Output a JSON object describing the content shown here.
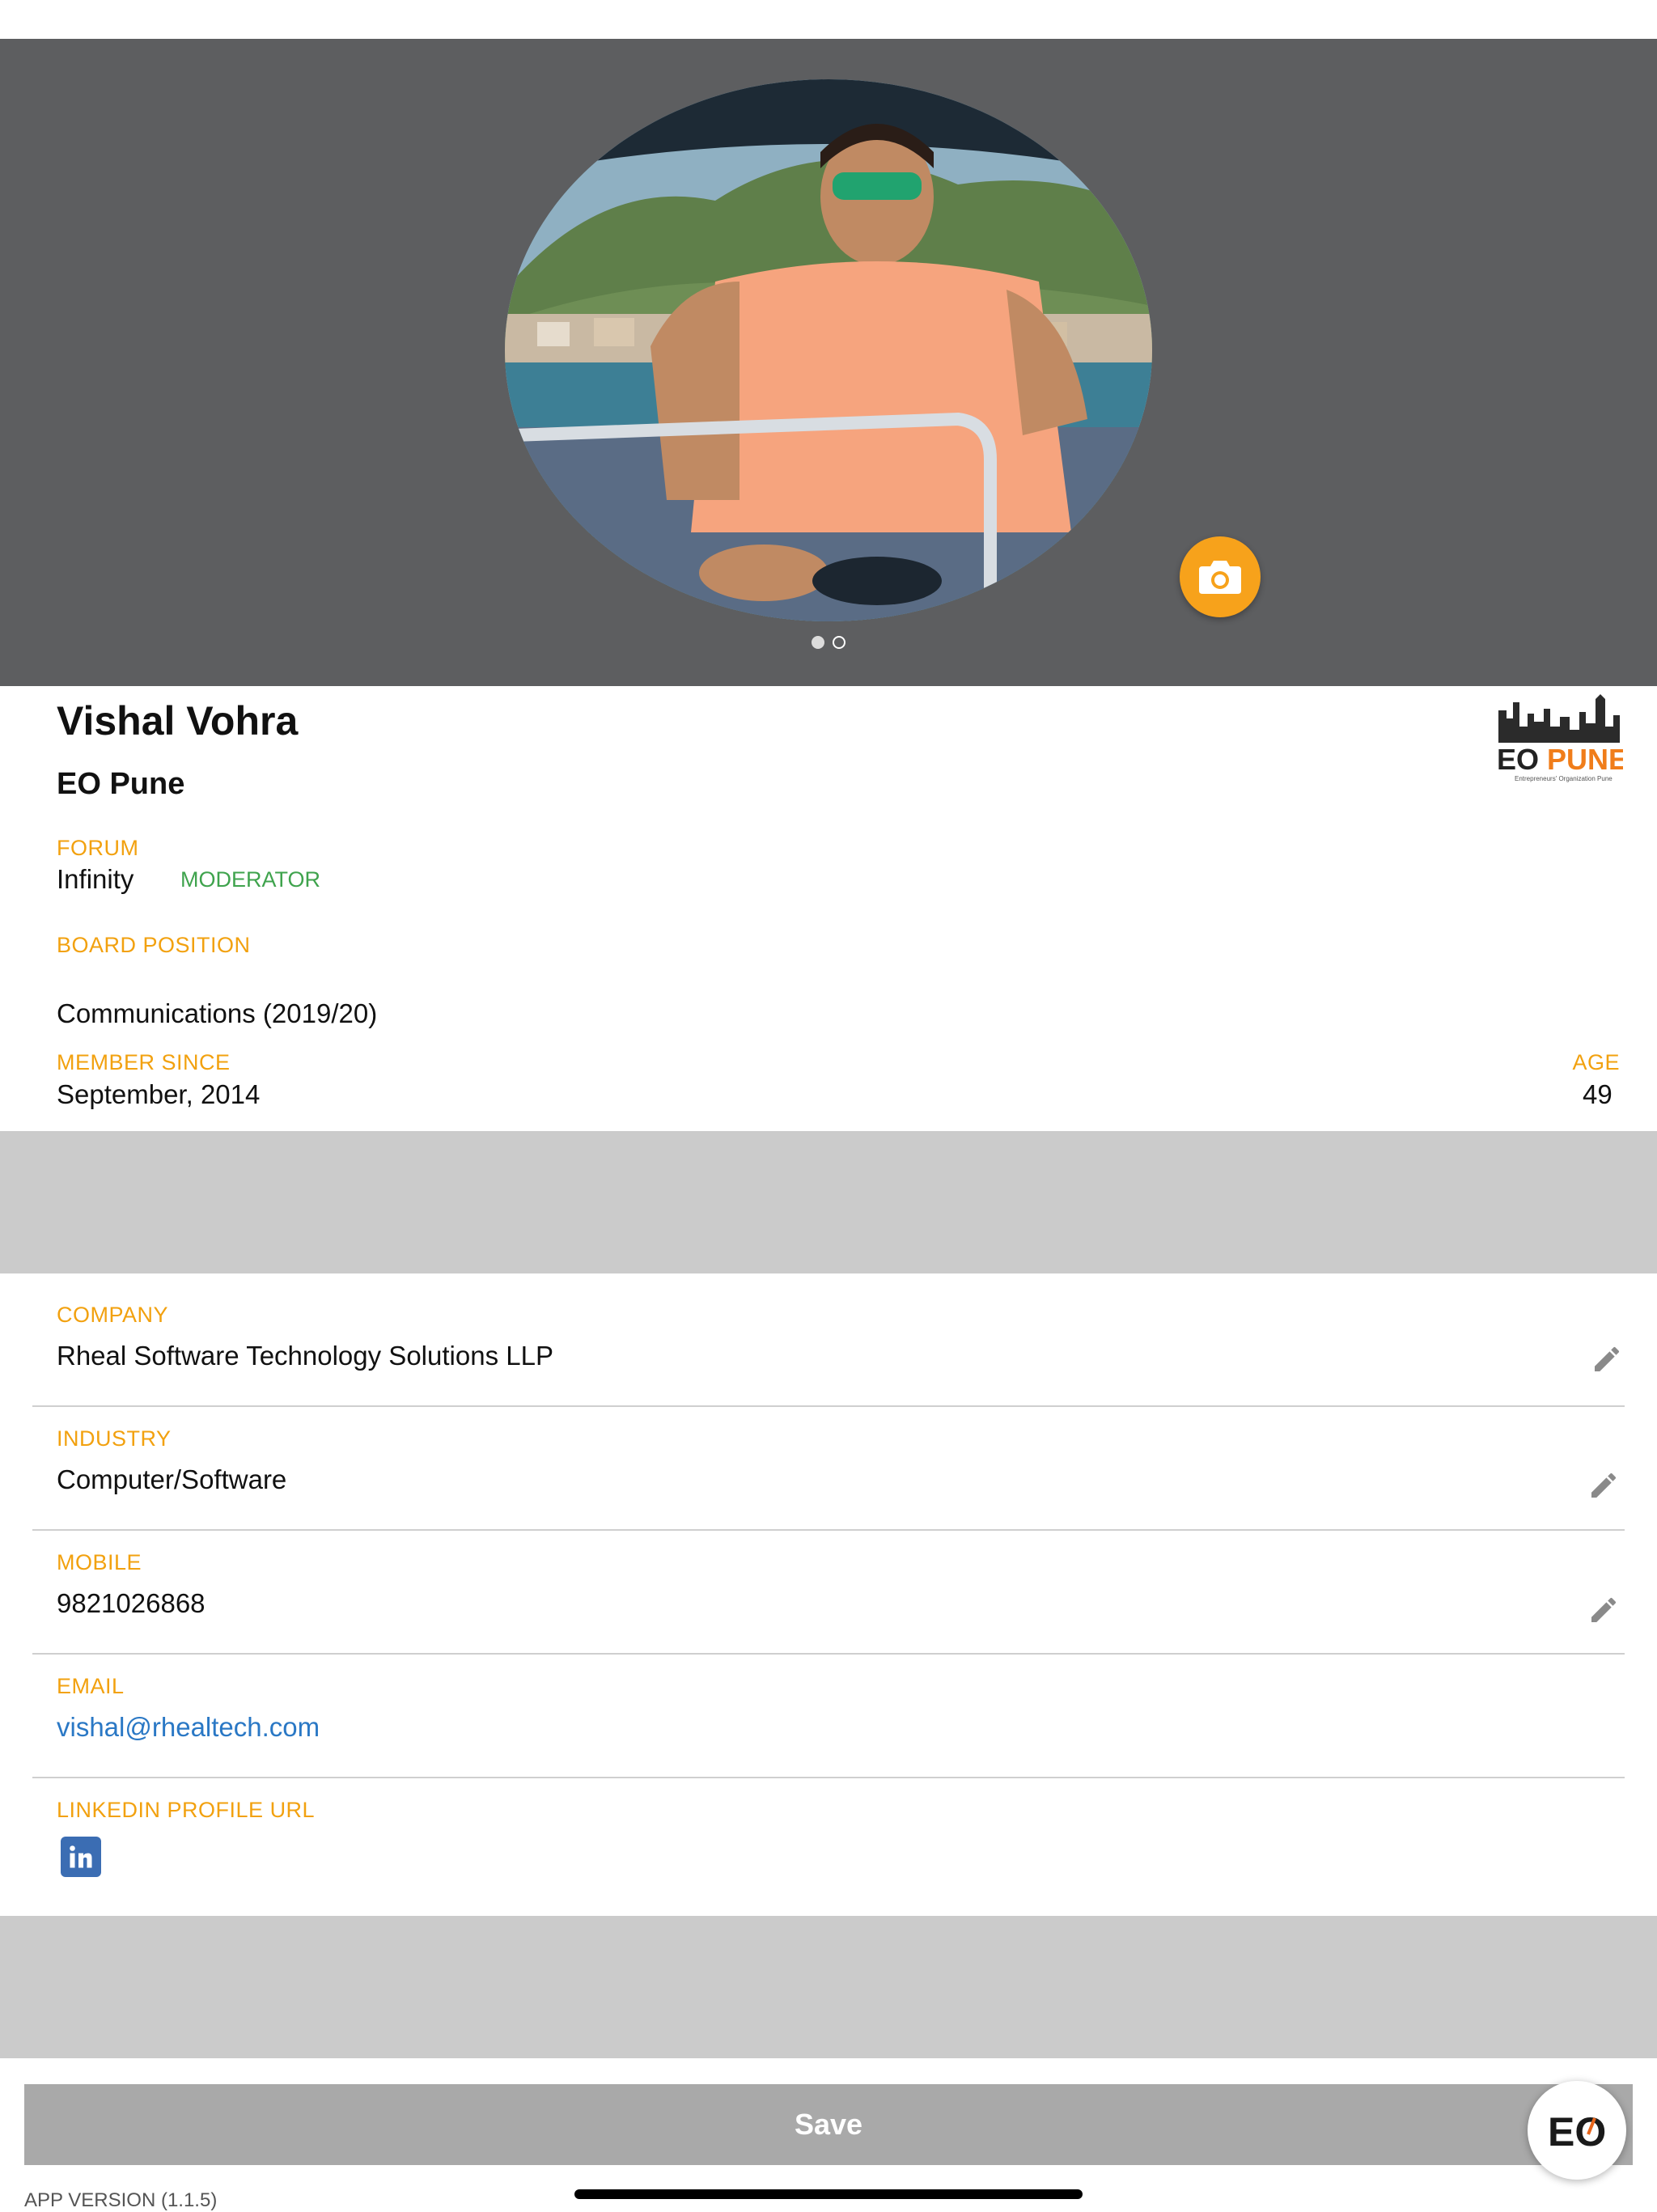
{
  "profile": {
    "name": "Vishal Vohra",
    "chapter": "EO Pune",
    "forum_label": "FORUM",
    "forum_value": "Infinity",
    "forum_role": "MODERATOR",
    "board_position_label": "BOARD POSITION",
    "board_position_value": "Communications (2019/20)",
    "member_since_label": "MEMBER SINCE",
    "member_since_value": "September, 2014",
    "age_label": "AGE",
    "age_value": "49",
    "photo_pages": 2,
    "photo_page_current": 1
  },
  "contact": {
    "company_label": "COMPANY",
    "company_value": "Rheal Software Technology Solutions LLP",
    "industry_label": "INDUSTRY",
    "industry_value": "Computer/Software",
    "mobile_label": "MOBILE",
    "mobile_value": "9821026868",
    "email_label": "EMAIL",
    "email_value": "vishal@rhealtech.com",
    "linkedin_label": "LINKEDIN PROFILE URL"
  },
  "logo": {
    "brand_eo": "EO",
    "brand_city": "PUNE",
    "tagline": "Entrepreneurs' Organization Pune"
  },
  "actions": {
    "save_label": "Save",
    "fab_label": "EO"
  },
  "footer": {
    "app_version": "APP VERSION (1.1.5)"
  },
  "icons": {
    "camera": "camera-icon",
    "edit": "pencil-icon",
    "linkedin": "linkedin-icon"
  },
  "colors": {
    "accent_orange": "#f2a10f",
    "moderator_green": "#3fa34d",
    "link_blue": "#2a78c5",
    "hero_gray": "#5d5e60",
    "band_gray": "#cbcbcb",
    "save_gray": "#a9a9a9"
  }
}
